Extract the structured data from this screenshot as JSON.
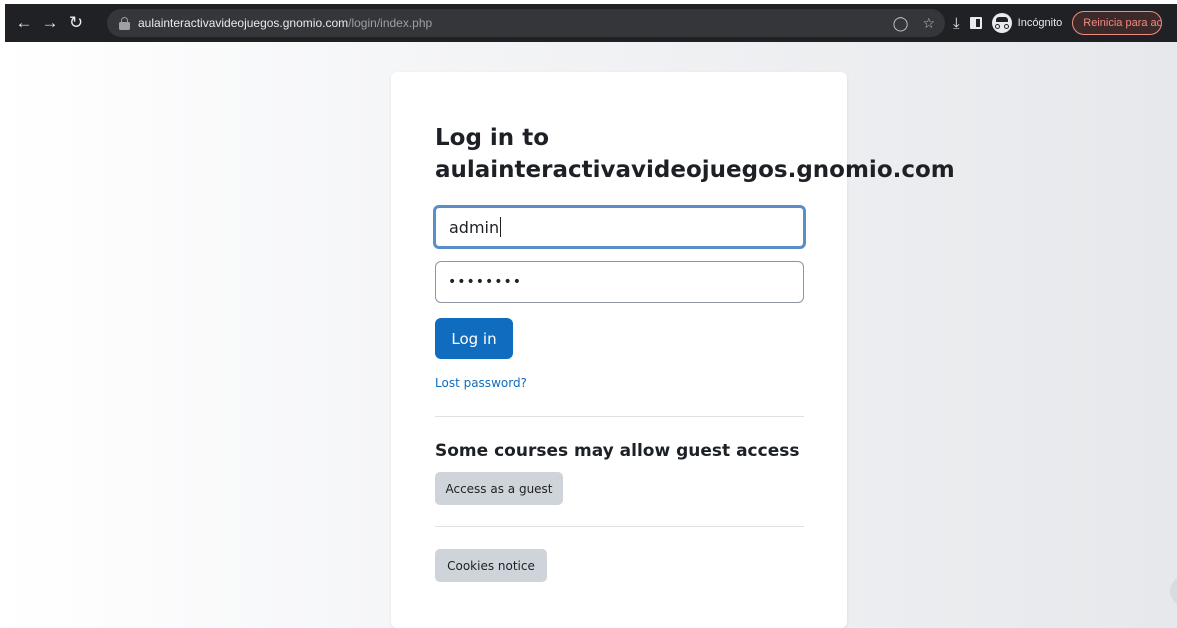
{
  "browser": {
    "url_host": "aulainteractivavideojuegos.gnomio.com",
    "url_path": "/login/index.php",
    "incognito_label": "Incógnito",
    "relaunch_label": "Reinicia para ac"
  },
  "login": {
    "title_line1": "Log in to",
    "title_line2": "aulainteractivavideojuegos.gnomio.com",
    "username_value": "admin",
    "password_value": "••••••••",
    "login_button": "Log in",
    "lost_password": "Lost password?",
    "guest_heading": "Some courses may allow guest access",
    "guest_button": "Access as a guest",
    "cookies_button": "Cookies notice"
  },
  "colors": {
    "primary": "#0f6cbf",
    "secondary": "#ced4da",
    "focus": "#5b8dc8"
  }
}
